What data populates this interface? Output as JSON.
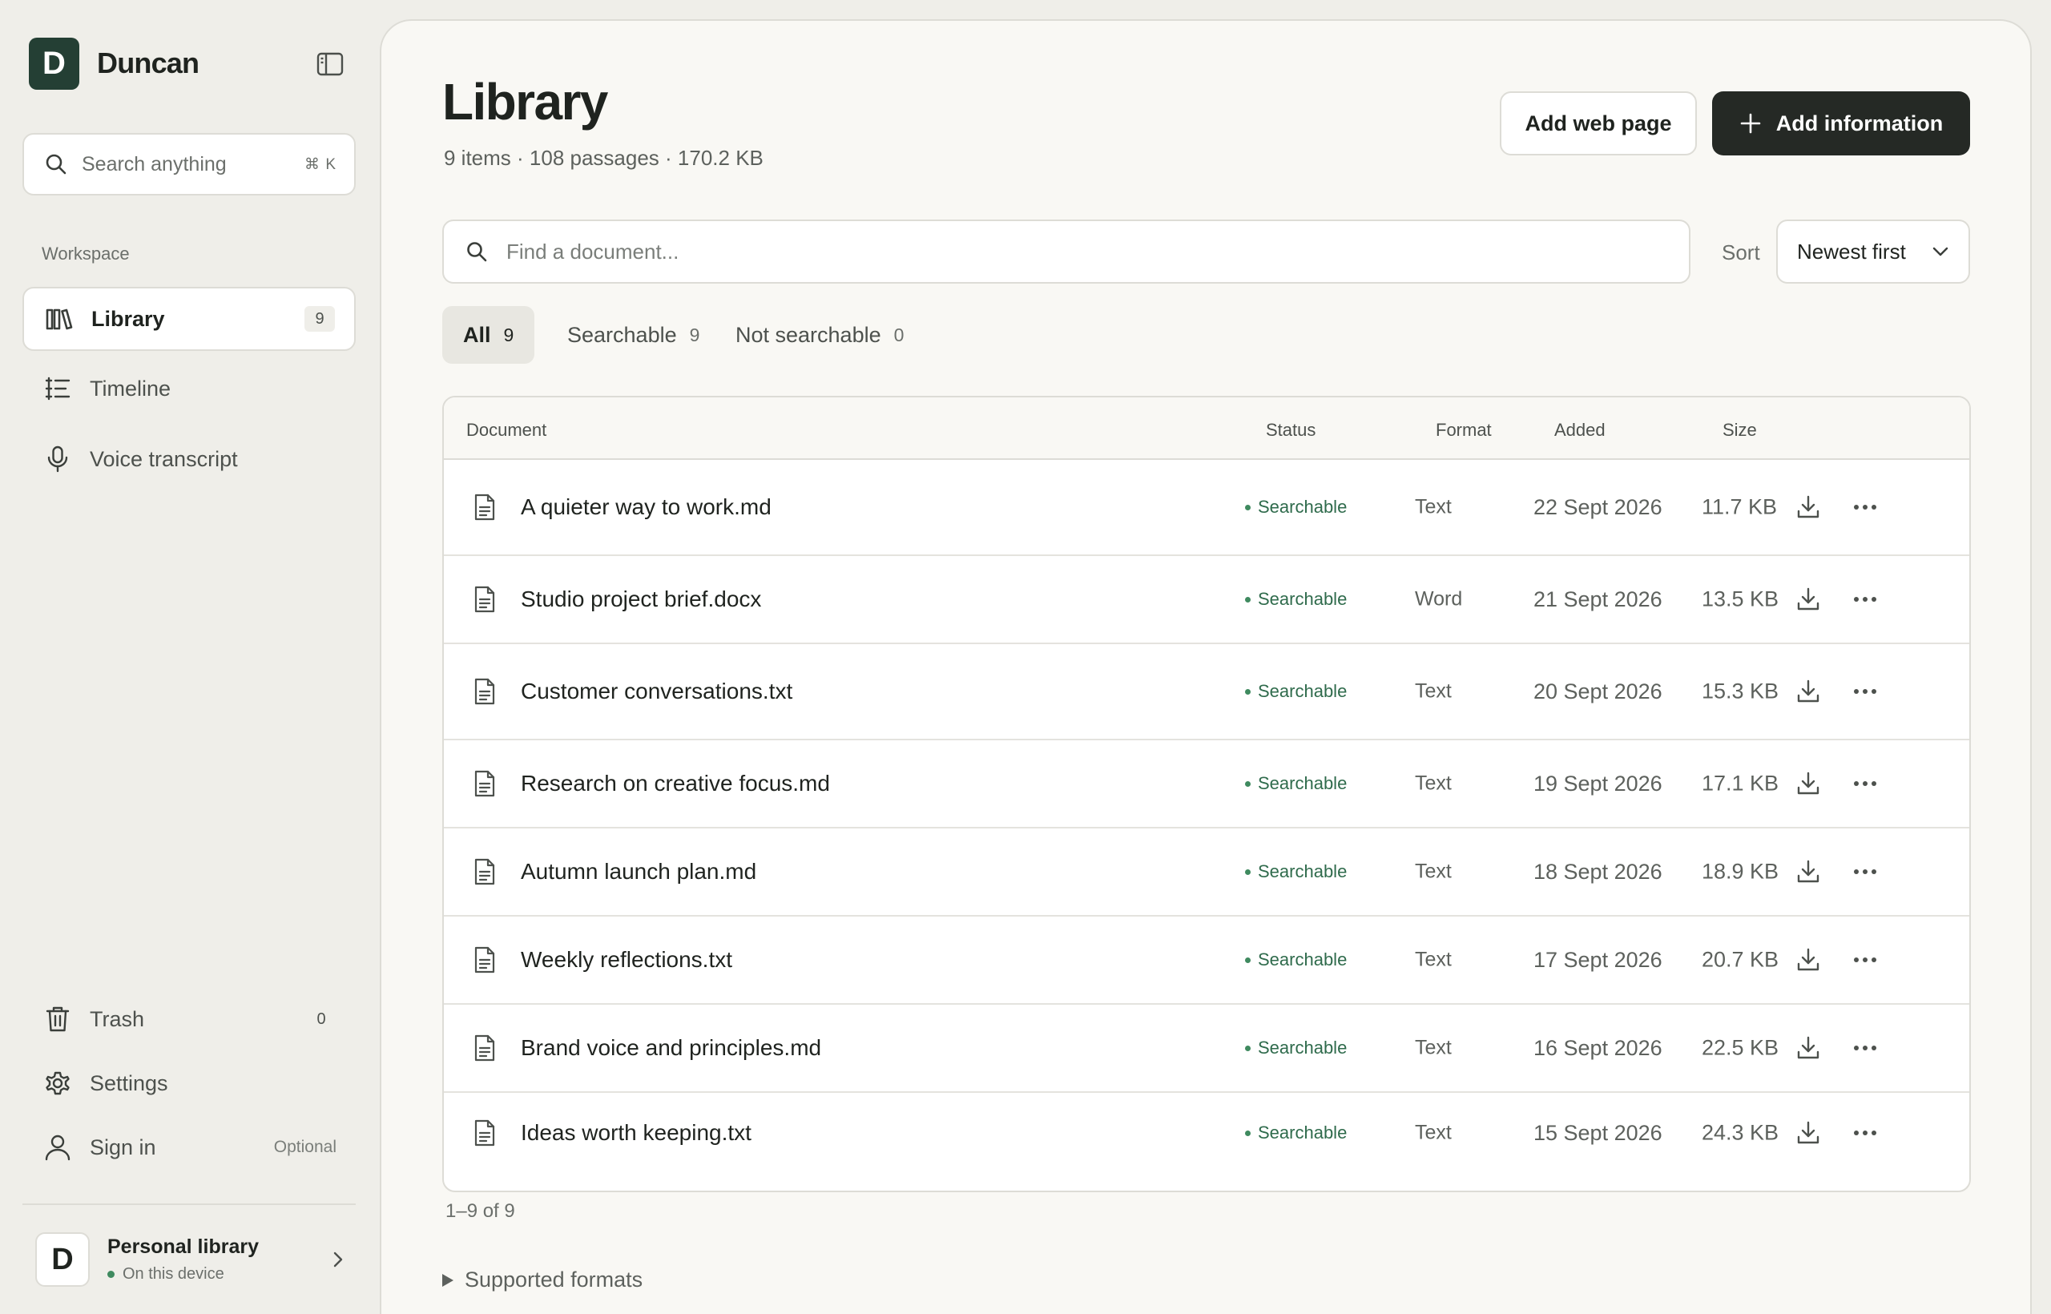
{
  "brand": {
    "initial": "D",
    "name": "Duncan"
  },
  "sidebar": {
    "search_placeholder": "Search anything",
    "search_shortcut": "⌘ K",
    "section_label": "Workspace",
    "items": [
      {
        "label": "Library",
        "count": "9",
        "icon": "books-icon"
      },
      {
        "label": "Timeline",
        "icon": "timeline-icon"
      },
      {
        "label": "Voice transcript",
        "icon": "microphone-icon"
      }
    ],
    "bottom_items": [
      {
        "label": "Trash",
        "count": "0",
        "icon": "trash-icon"
      },
      {
        "label": "Settings",
        "icon": "gear-icon"
      },
      {
        "label": "Sign in",
        "aside": "Optional",
        "icon": "user-icon"
      }
    ],
    "profile": {
      "initial": "D",
      "name": "Personal library",
      "status": "On this device"
    }
  },
  "main": {
    "title": "Library",
    "meta": "9 items · 108 passages · 170.2 KB",
    "add_web_page_label": "Add web page",
    "add_information_label": "Add information",
    "doc_search_placeholder": "Find a document...",
    "sort_label": "Sort",
    "sort_value": "Newest first",
    "tabs": [
      {
        "label": "All",
        "count": "9"
      },
      {
        "label": "Searchable",
        "count": "9"
      },
      {
        "label": "Not searchable",
        "count": "0"
      }
    ],
    "columns": {
      "document": "Document",
      "status": "Status",
      "format": "Format",
      "added": "Added",
      "size": "Size"
    },
    "rows": [
      {
        "name": "A quieter way to work.md",
        "status": "Searchable",
        "format": "Text",
        "added": "22 Sept 2026",
        "size": "11.7 KB"
      },
      {
        "name": "Studio project brief.docx",
        "status": "Searchable",
        "format": "Word",
        "added": "21 Sept 2026",
        "size": "13.5 KB"
      },
      {
        "name": "Customer conversations.txt",
        "status": "Searchable",
        "format": "Text",
        "added": "20 Sept 2026",
        "size": "15.3 KB"
      },
      {
        "name": "Research on creative focus.md",
        "status": "Searchable",
        "format": "Text",
        "added": "19 Sept 2026",
        "size": "17.1 KB"
      },
      {
        "name": "Autumn launch plan.md",
        "status": "Searchable",
        "format": "Text",
        "added": "18 Sept 2026",
        "size": "18.9 KB"
      },
      {
        "name": "Weekly reflections.txt",
        "status": "Searchable",
        "format": "Text",
        "added": "17 Sept 2026",
        "size": "20.7 KB"
      },
      {
        "name": "Brand voice and principles.md",
        "status": "Searchable",
        "format": "Text",
        "added": "16 Sept 2026",
        "size": "22.5 KB"
      },
      {
        "name": "Ideas worth keeping.txt",
        "status": "Searchable",
        "format": "Text",
        "added": "15 Sept 2026",
        "size": "24.3 KB"
      }
    ],
    "pagination": "1–9 of 9",
    "supported_formats_label": "Supported formats"
  },
  "colors": {
    "accent": "#243f34",
    "primary_button": "#252925",
    "status_green": "#3f8a5f",
    "background": "#efeee9"
  }
}
